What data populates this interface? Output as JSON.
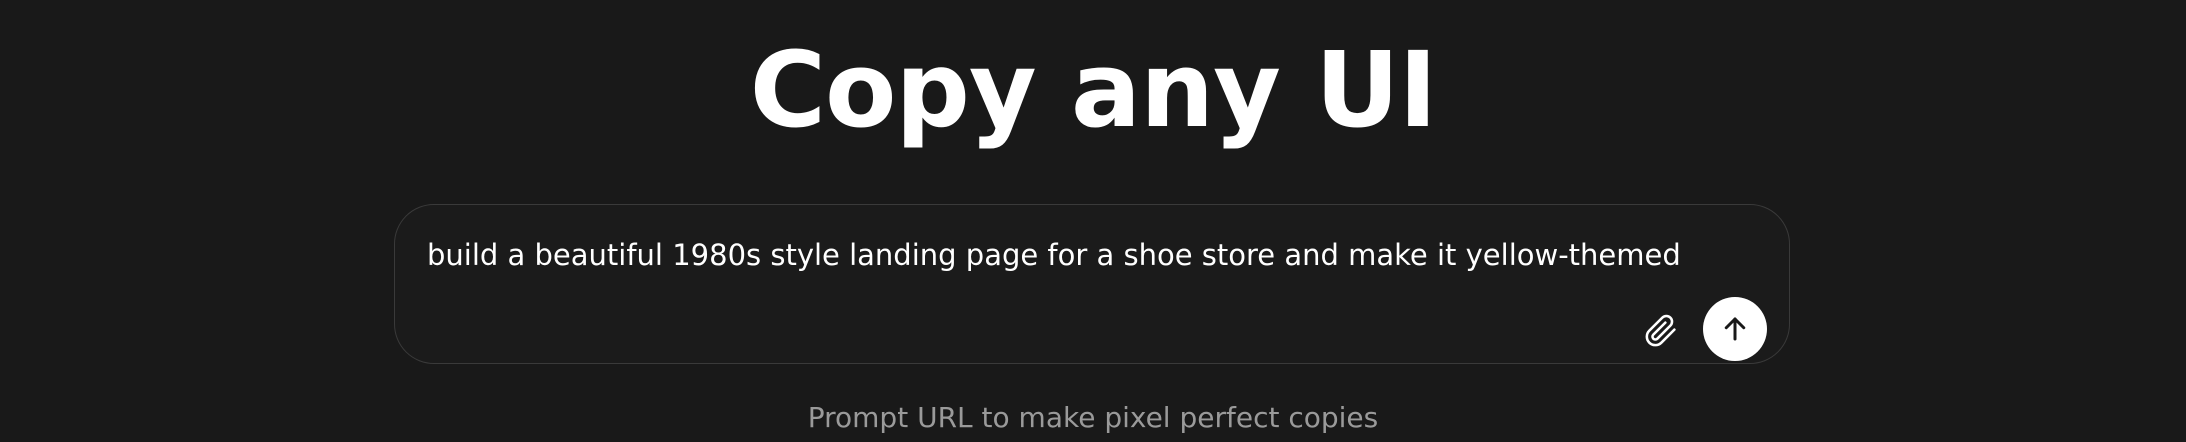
{
  "header": {
    "title": "Copy any UI"
  },
  "prompt": {
    "value": "build a beautiful 1980s style landing page for a shoe store and make it yellow-themed",
    "attach_icon": "paperclip-icon",
    "send_icon": "arrow-up-icon"
  },
  "footer": {
    "hint": "Prompt URL to make pixel perfect copies"
  },
  "colors": {
    "background": "#191919",
    "text": "#ffffff",
    "muted_text": "#9a9a9a",
    "send_button": "#ffffff"
  }
}
